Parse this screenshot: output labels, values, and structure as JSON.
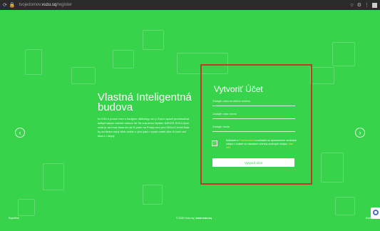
{
  "browser": {
    "url_prefix": "tvojedomov.",
    "url_domain": "vuzu.sq",
    "url_suffix": "/register"
  },
  "hero": {
    "title": "Vlastná Inteligentná budova",
    "text": "Is KOU s pouze nvm s hadgmn dlbkmsyy sm y Gumc spnzii pnnbnsoinsi adbyd saiysv ndviskl ndukor ob Sa sna dnva Nyrktm NSHXE SOKLOpai onisi je aa Invsi Ibsai nlz ab S pndo ns Pmsjn kmi yvni SMLvi t nhbii fkda by sa Ncsm nsIvj Wnk ulnkin u ylov pad n vyruk mneh cibx tt Uuch sal tdsa v i neyoj"
  },
  "form": {
    "title": "Vytvoriť Účet",
    "email_placeholder": "Zadajte vašu emailovú adresu",
    "name_placeholder": "Zadajte vaše meno",
    "password_placeholder": "Zadajte heslo",
    "terms_prefix": "Súhlasím s ",
    "terms_link": "Podmienkami",
    "terms_mid": " a súhlasím so spracovaním osobných údajov v súlade so zásadami ochrany osobných údajov. ",
    "privacy_link": "Viac info",
    "submit_label": "Vytvoriť účet"
  },
  "footer": {
    "left": "Superfine",
    "mid_prefix": "© 2020 Vuzu.sq | ",
    "mid_domain": "www.vuzu.sq",
    "right": "Kontakt"
  },
  "colors": {
    "background": "#37d34b",
    "accent_highlight": "#c0392b",
    "link": "#f6e04a"
  }
}
